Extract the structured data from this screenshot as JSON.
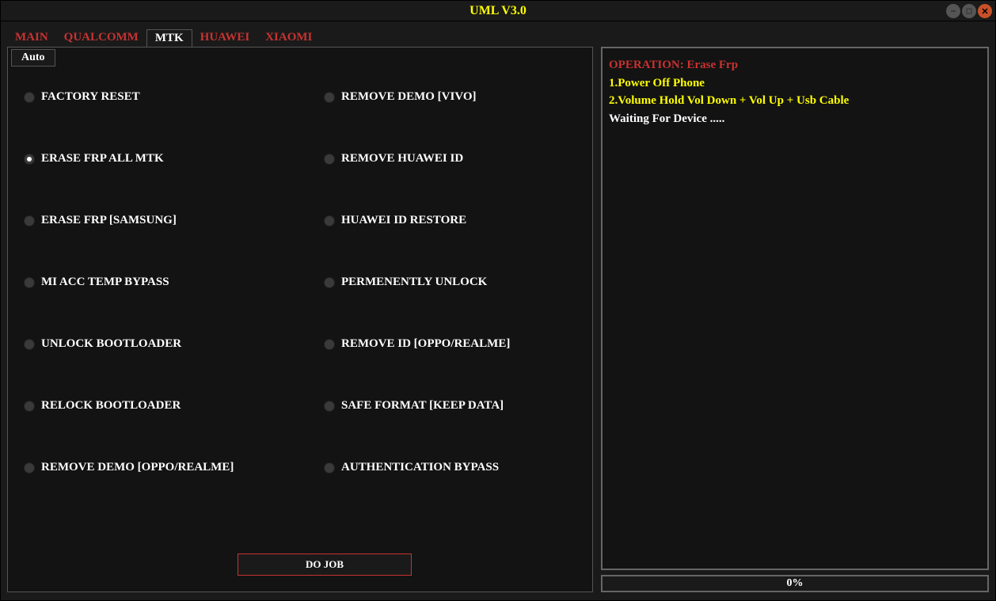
{
  "window": {
    "title": "UML V3.0"
  },
  "tabs": [
    {
      "label": "MAIN",
      "active": false
    },
    {
      "label": "QUALCOMM",
      "active": false
    },
    {
      "label": "MTK",
      "active": true
    },
    {
      "label": "HUAWEI",
      "active": false
    },
    {
      "label": "XIAOMI",
      "active": false
    }
  ],
  "sub_tab": {
    "label": "Auto"
  },
  "options": {
    "left_column": [
      {
        "label": "FACTORY RESET",
        "selected": false
      },
      {
        "label": "ERASE FRP ALL MTK",
        "selected": true
      },
      {
        "label": "ERASE FRP [SAMSUNG]",
        "selected": false
      },
      {
        "label": "MI ACC TEMP BYPASS",
        "selected": false
      },
      {
        "label": "UNLOCK BOOTLOADER",
        "selected": false
      },
      {
        "label": "RELOCK BOOTLOADER",
        "selected": false
      },
      {
        "label": "REMOVE DEMO [OPPO/REALME]",
        "selected": false
      }
    ],
    "right_column": [
      {
        "label": "REMOVE DEMO [VIVO]",
        "selected": false
      },
      {
        "label": "REMOVE HUAWEI ID",
        "selected": false
      },
      {
        "label": "HUAWEI ID RESTORE",
        "selected": false
      },
      {
        "label": "PERMENENTLY UNLOCK",
        "selected": false
      },
      {
        "label": "REMOVE ID [OPPO/REALME]",
        "selected": false
      },
      {
        "label": "SAFE FORMAT [KEEP DATA]",
        "selected": false
      },
      {
        "label": "AUTHENTICATION BYPASS",
        "selected": false
      }
    ]
  },
  "do_job": {
    "label": "DO JOB"
  },
  "log": {
    "lines": [
      {
        "text": "OPERATION: Erase Frp",
        "color": "red"
      },
      {
        "text": "1.Power Off Phone",
        "color": "yellow"
      },
      {
        "text": "2.Volume Hold Vol Down + Vol Up + Usb Cable",
        "color": "yellow"
      },
      {
        "text": "Waiting For Device .....",
        "color": "white"
      }
    ]
  },
  "progress": {
    "label": "0%"
  }
}
